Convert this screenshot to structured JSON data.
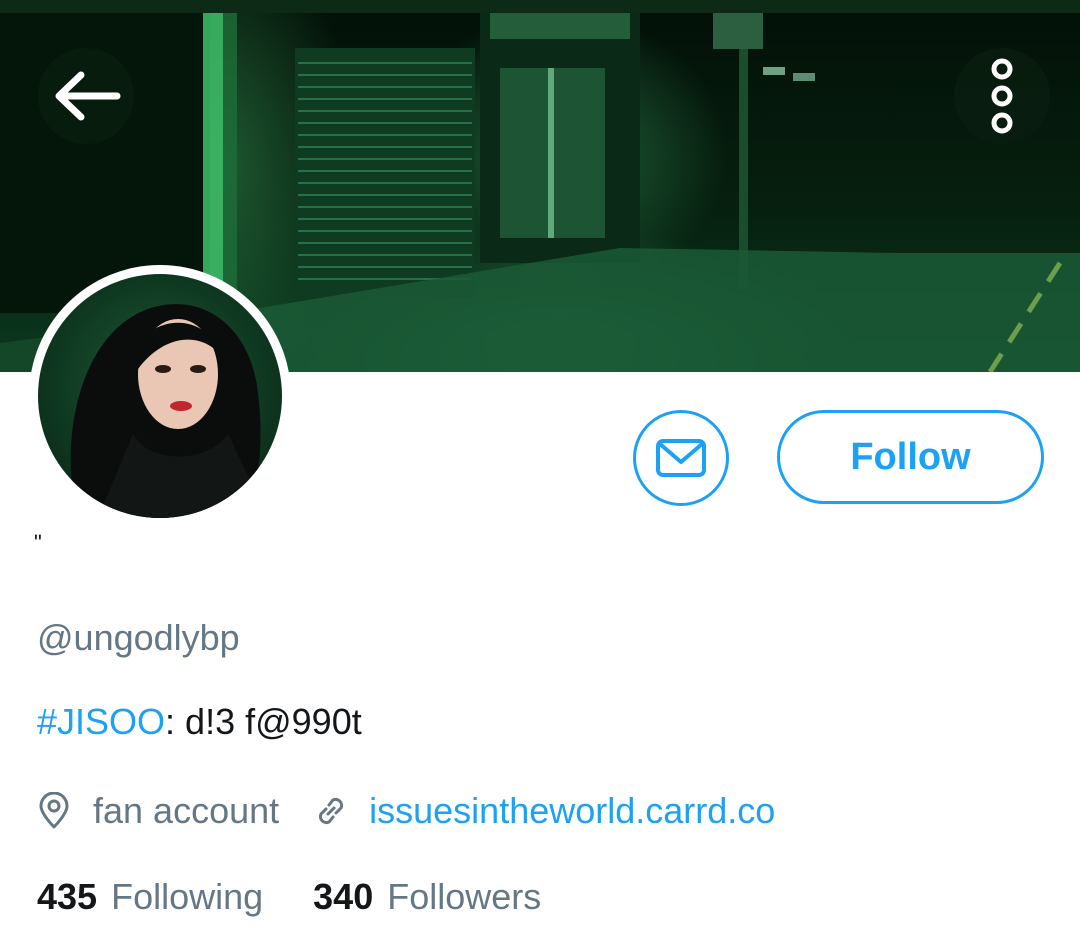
{
  "header": {
    "back_icon": "arrow-left-icon",
    "more_icon": "more-vertical-icon"
  },
  "profile": {
    "display_name": "ʺ",
    "handle": "@ungodlybp",
    "bio": {
      "hashtag": "#JISOO",
      "text": ": d!3 f@990t"
    },
    "location_icon": "location-pin-icon",
    "location": "fan account",
    "link_icon": "link-icon",
    "website": "issuesintheworld.carrd.co"
  },
  "actions": {
    "message_icon": "envelope-icon",
    "follow_label": "Follow"
  },
  "stats": {
    "following_count": "435",
    "following_label": "Following",
    "followers_count": "340",
    "followers_label": "Followers"
  },
  "colors": {
    "accent": "#1da1f2",
    "secondary_text": "#657786",
    "primary_text": "#14171a",
    "banner_tint": "#0b3a1f"
  }
}
